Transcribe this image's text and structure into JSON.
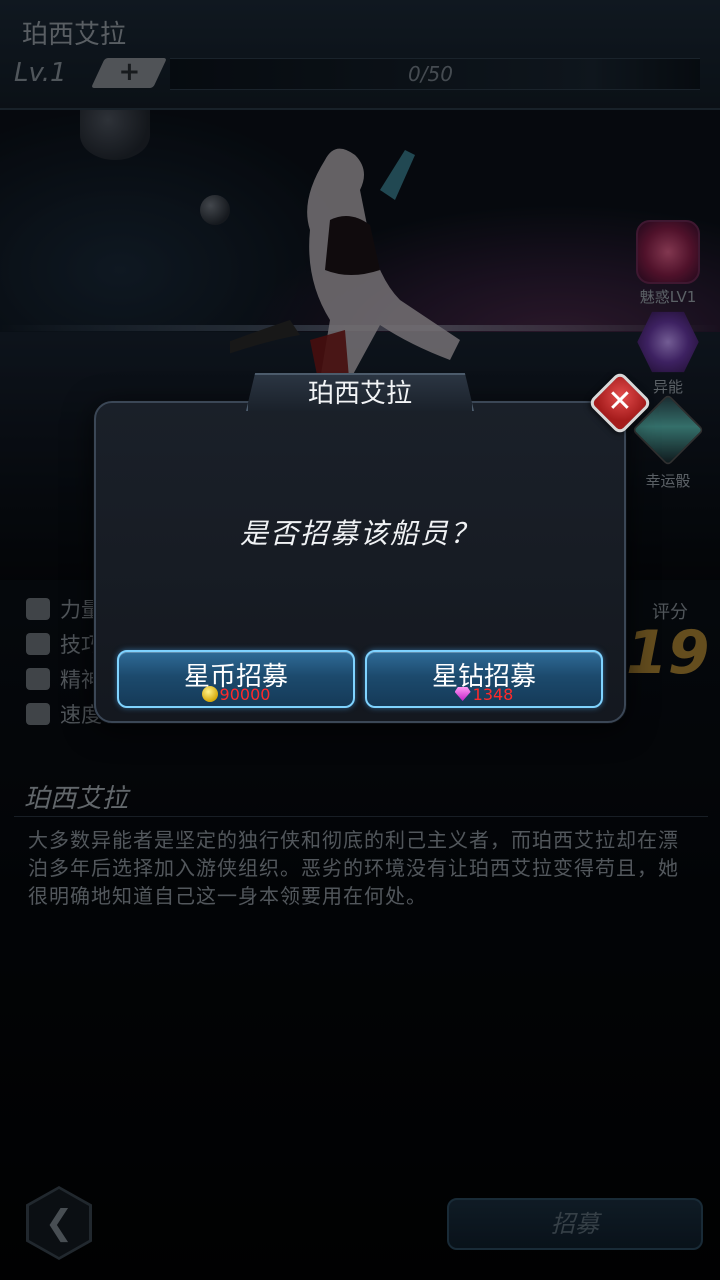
{
  "header": {
    "character_name": "珀西艾拉",
    "level": "Lv.1",
    "plus_label": "+",
    "xp": "0/50"
  },
  "skills": [
    {
      "label": "魅惑LV1",
      "icon": "heart-charm-icon"
    },
    {
      "label": "异能",
      "icon": "psionic-sun-icon"
    },
    {
      "label": "幸运骰",
      "icon": "lucky-dice-icon"
    }
  ],
  "stats": [
    {
      "label": "力量",
      "icon": "fist-icon"
    },
    {
      "label": "技巧",
      "icon": "crossed-tools-icon"
    },
    {
      "label": "精神",
      "icon": "brain-icon"
    },
    {
      "label": "速度",
      "icon": "hourglass-icon"
    }
  ],
  "score": {
    "label": "评分",
    "value": "19"
  },
  "description": {
    "title": "珀西艾拉",
    "text": "大多数异能者是坚定的独行侠和彻底的利己主义者，而珀西艾拉却在漂泊多年后选择加入游侠组织。恶劣的环境没有让珀西艾拉变得苟且，她很明确地知道自己这一身本领要用在何处。"
  },
  "bottom": {
    "back_label": "❮",
    "recruit_label": "招募"
  },
  "modal": {
    "title": "珀西艾拉",
    "close_label": "✕",
    "question": "是否招募该船员？",
    "coin_button": {
      "label": "星币招募",
      "cost": "90000"
    },
    "diamond_button": {
      "label": "星钻招募",
      "cost": "1348"
    }
  },
  "colors": {
    "button_border": "#7fd3ff",
    "cost_text": "#ff2a2a",
    "close_button": "#c62828",
    "score": "#c99a3a"
  }
}
